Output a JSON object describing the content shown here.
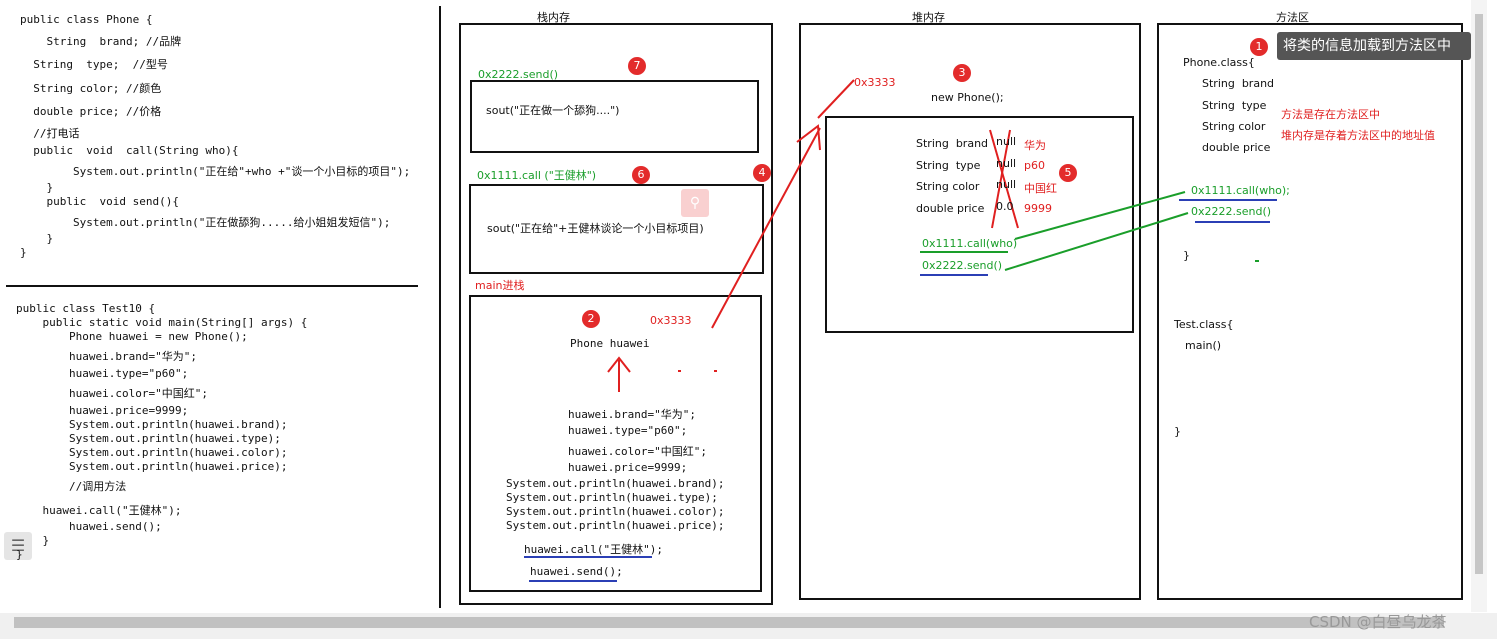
{
  "code_phone": [
    "public class Phone {",
    "    String  brand; //品牌",
    "  String  type;  //型号",
    "  String color; //颜色",
    "  double price; //价格",
    "  //打电话",
    "  public  void  call(String who){",
    "        System.out.println(\"正在给\"+who +\"谈一个小目标的项目\");",
    "    }",
    "    public  void send(){",
    "        System.out.println(\"正在做舔狗.....给小姐姐发短信\");",
    "    }",
    "}"
  ],
  "code_test": [
    "public class Test10 {",
    "    public static void main(String[] args) {",
    "        Phone huawei = new Phone();",
    "        huawei.brand=\"华为\";",
    "        huawei.type=\"p60\";",
    "        huawei.color=\"中国红\";",
    "        huawei.price=9999;",
    "        System.out.println(huawei.brand);",
    "        System.out.println(huawei.type);",
    "        System.out.println(huawei.color);",
    "        System.out.println(huawei.price);",
    "        //调用方法",
    "    huawei.call(\"王健林\");",
    "        huawei.send();",
    "    }",
    "}"
  ],
  "stack": {
    "title": "栈内存",
    "send_frame_label": "0x2222.send()",
    "send_frame_text": "sout(\"正在做一个舔狗....\")",
    "call_frame_label": "0x1111.call  (\"王健林\")",
    "call_frame_text": "sout(\"正在给\"+王健林谈论一个小目标项目)",
    "main_label": "main进栈",
    "main_addr": "0x3333",
    "main_var": "Phone  huawei",
    "main_lines": [
      "huawei.brand=\"华为\";",
      "huawei.type=\"p60\";",
      "huawei.color=\"中国红\";",
      "huawei.price=9999;",
      "System.out.println(huawei.brand);",
      "System.out.println(huawei.type);",
      "System.out.println(huawei.color);",
      "System.out.println(huawei.price);"
    ],
    "main_call": "huawei.call(\"王健林\");",
    "main_send": "huawei.send();"
  },
  "heap": {
    "title": "堆内存",
    "addr": "0x3333",
    "new_phone": "new Phone();",
    "fields": [
      {
        "name": "String  brand",
        "default": "null",
        "value": "华为"
      },
      {
        "name": "String  type",
        "default": "null",
        "value": "p60"
      },
      {
        "name": "String color",
        "default": "null",
        "value": "中国红"
      },
      {
        "name": "double price",
        "default": "0.0",
        "value": "9999"
      }
    ],
    "call_ref": "0x1111.call(who)",
    "send_ref": "0x2222.send()"
  },
  "method_area": {
    "title": "方法区",
    "tooltip": "将类的信息加载到方法区中",
    "phone_class": "Phone.class{",
    "fields": [
      "String  brand",
      "String  type",
      "String color",
      "double price"
    ],
    "note1": "方法是存在方法区中",
    "note2": "堆内存是存着方法区中的地址值",
    "call_addr": "0x1111.call(who);",
    "send_addr": "0x2222.send()",
    "close1": "}",
    "test_class": "Test.class{",
    "main": "main()",
    "close2": "}"
  },
  "badges": [
    "1",
    "2",
    "3",
    "4",
    "5",
    "6",
    "7"
  ],
  "watermark": "CSDN @白昼乌龙茶",
  "icons": {
    "toc": "list-icon",
    "search": "search-icon"
  },
  "colors": {
    "red": "#e02020",
    "green": "#1a9e2a",
    "blue": "#2b3fb5"
  }
}
